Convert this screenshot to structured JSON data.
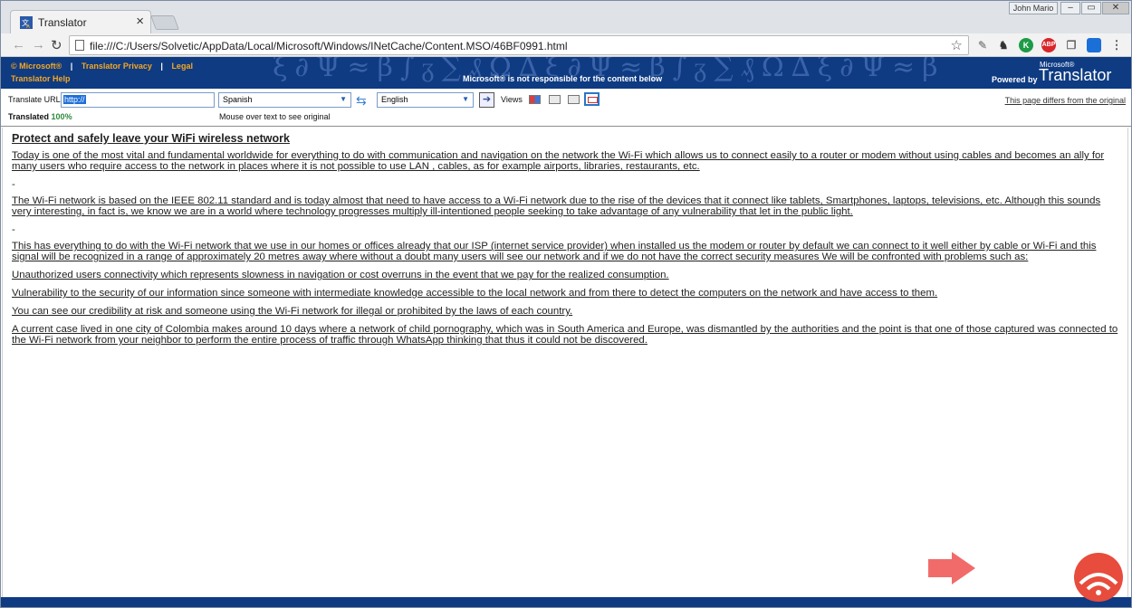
{
  "browser": {
    "tab_title": "Translator",
    "tab_close": "×",
    "user_name": "John Mario",
    "win_min": "–",
    "win_max": "▭",
    "win_close": "✕",
    "url": "file:///C:/Users/Solvetic/AppData/Local/Microsoft/Windows/INetCache/Content.MSO/46BF0991.html"
  },
  "banner": {
    "link_microsoft": "© Microsoft®",
    "sep1": "|",
    "link_privacy": "Translator Privacy",
    "sep2": "|",
    "link_legal": "Legal",
    "link_help": "Translator Help",
    "disclaimer": "Microsoft® is not responsible for the content below",
    "powered_by": "Powered by",
    "brand_small": "Microsoft®",
    "brand": "Translator"
  },
  "controls": {
    "translate_url_label": "Translate URL",
    "url_value": "http://",
    "from_language": "Spanish",
    "to_language": "English",
    "views_label": "Views",
    "translated_label": "Translated",
    "translated_percent": "100%",
    "mouse_hint": "Mouse over text to see original",
    "differs_link": "This page differs from the original"
  },
  "article": {
    "title": "Protect and safely leave your WiFi wireless network",
    "dash": "-",
    "paragraphs": [
      "Today is one of the most vital and fundamental worldwide for everything to do with communication and navigation on the network the Wi-Fi which allows us to connect easily to a router or modem without using cables and becomes an ally for many users who require access to the network in places where it is not possible to use LAN , cables, as for example airports, libraries, restaurants, etc.",
      "The Wi-Fi network is based on the IEEE 802.11 standard and is today almost that need to have access to a Wi-Fi network due to the rise of the devices that it connect like tablets, Smartphones, laptops, televisions, etc. Although this sounds very interesting, in fact is, we know we are in a world where technology progresses multiply ill-intentioned people seeking to take advantage of any vulnerability that let in the public light.",
      "This has everything to do with the Wi-Fi network that we use in our homes or offices already that our ISP (internet service provider) when installed us the modem or router by default we can connect to it well either by cable or Wi-Fi and this signal will be recognized in a range of approximately 20 metres away where without a doubt many users will see our network and if we do not have the correct security measures We will be confronted with problems such as:",
      "Unauthorized users connectivity which represents slowness in navigation or cost overruns in the event that we pay for the realized consumption.",
      "Vulnerability to the security of our information since someone with intermediate knowledge accessible to the local network and from there to detect the computers on the network and have access to them.",
      "You can see our credibility at risk and someone using the Wi-Fi network for illegal or prohibited by the laws of each country.",
      "A current case lived in one city of Colombia makes around 10 days where a network of child pornography, which was in South America and Europe, was dismantled by the authorities and the point is that one of those captured was connected to the Wi-Fi network from your neighbor to perform the entire process of traffic through WhatsApp thinking that thus it could not be discovered."
    ]
  },
  "colors": {
    "banner_bg": "#0e3b82",
    "banner_link": "#f5a623",
    "translated_percent": "#2e8b3a",
    "arrow": "#f26b6b",
    "watermark": "#e74c3c"
  },
  "icons": [
    "translator-favicon",
    "back-icon",
    "forward-icon",
    "reload-icon",
    "page-icon",
    "star-icon",
    "pen-icon",
    "spy-icon",
    "k-extension-icon",
    "abp-icon",
    "copy-icon",
    "blue-extension-icon",
    "menu-icon",
    "swap-icon",
    "go-arrow-icon",
    "view-side-by-side-icon",
    "view-top-bottom-icon",
    "view-original-hover-icon",
    "view-translation-icon",
    "pointer-arrow-icon",
    "solvetic-logo-icon"
  ]
}
